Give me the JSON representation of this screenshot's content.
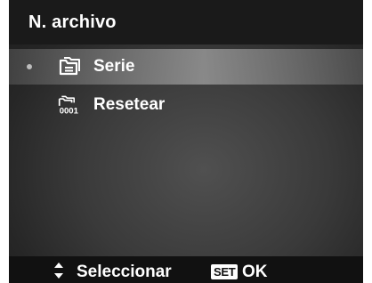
{
  "header": {
    "title": "N. archivo"
  },
  "menu": {
    "items": [
      {
        "label": "Serie",
        "icon": "folder-series-icon",
        "selected": true
      },
      {
        "label": "Resetear",
        "icon": "folder-reset-icon",
        "icon_number": "0001",
        "selected": false
      }
    ]
  },
  "footer": {
    "select_icon": "up-down-arrows-icon",
    "select_label": "Seleccionar",
    "set_badge": "SET",
    "ok_label": "OK"
  },
  "colors": {
    "header_bg": "#1a1a1a",
    "footer_bg": "#111111",
    "text": "#ffffff",
    "highlight": "#9a9a9a"
  }
}
